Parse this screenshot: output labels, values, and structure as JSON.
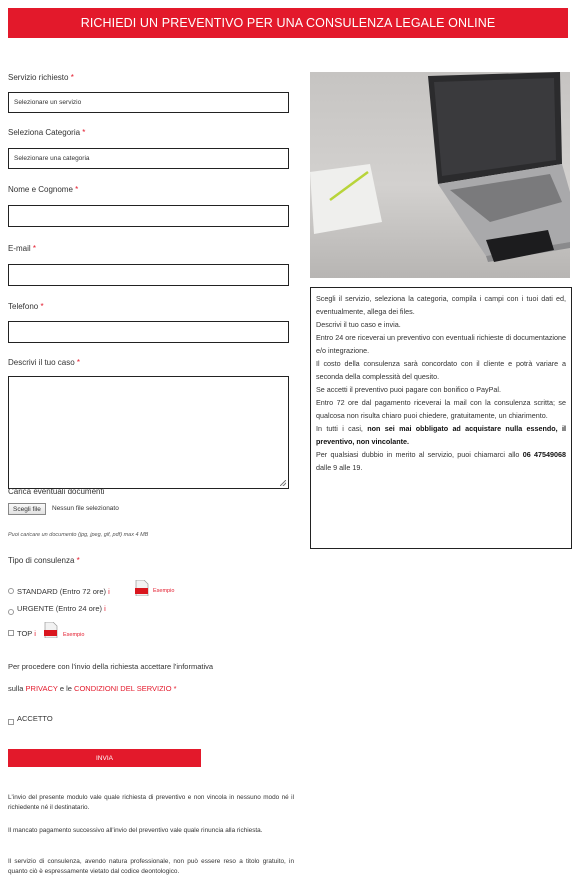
{
  "banner": "RICHIEDI UN PREVENTIVO PER UNA CONSULENZA LEGALE ONLINE",
  "form": {
    "service_label": "Servizio richiesto",
    "service_value": "Selezionare un servizio",
    "category_label": "Seleziona Categoria",
    "category_value": "Selezionare una categoria",
    "name_label": "Nome e Cognome",
    "email_label": "E-mail",
    "phone_label": "Telefono",
    "case_label": "Descrivi il tuo caso",
    "upload_label": "Carica eventuali documenti",
    "file_button": "Scegli file",
    "file_status": "Nessun file selezionato",
    "upload_hint": "Puoi caricare un documento (jpg, jpeg, gif, pdf) max 4 MB",
    "type_label": "Tipo di consulenza",
    "options": [
      {
        "label": "STANDARD (Entro 72 ore)",
        "info": "i",
        "example": "Esempio"
      },
      {
        "label": "URGENTE (Entro 24 ore)",
        "info": "i"
      },
      {
        "label": "TOP",
        "info": "i",
        "example": "Esempio"
      }
    ],
    "privacy_line1": "Per procedere con l'invio della richiesta accettare l'informativa",
    "privacy_prefix": "sulla",
    "privacy_link": "PRIVACY",
    "privacy_mid": "e le",
    "conditions_link": "CONDIZIONI DEL SERVIZIO",
    "accept_label": "ACCETTO",
    "submit": "INVIA",
    "required_mark": "*"
  },
  "info": {
    "p1": "Scegli il servizio, seleziona la categoria, compila i campi con i tuoi dati ed, eventualmente, allega dei files.",
    "p2": "Descrivi il tuo caso e invia.",
    "p3": "Entro 24 ore riceverai un preventivo con eventuali richieste di documentazione e/o integrazione.",
    "p4": "Il costo della consulenza sarà concordato con il cliente e potrà variare a seconda della complessità del quesito.",
    "p5": "Se accetti il preventivo puoi pagare con bonifico o PayPal.",
    "p6": "Entro 72 ore dal pagamento riceverai la mail con la consulenza scritta; se qualcosa non risulta chiaro puoi chiedere, gratuitamente, un chiarimento.",
    "p7_pre": "In tutti i casi,",
    "p7_bold": "non sei mai obbligato ad acquistare nulla essendo, il preventivo, non vincolante.",
    "p8": "Per qualsiasi dubbio in merito al servizio, puoi chiamarci allo",
    "phone": "06 47549068",
    "p8_end": "dalle 9 alle 19."
  },
  "footer": {
    "f1": "L'invio del presente modulo vale quale richiesta di preventivo e non vincola in nessuno modo né il richiedente né il destinatario.",
    "f2": "Il mancato pagamento successivo all'invio del preventivo vale quale rinuncia alla richiesta.",
    "f3": "Il servizio di consulenza, avendo natura professionale, non può essere reso a titolo gratuito, in quanto ciò è espressamente vietato dal codice deontologico."
  },
  "colors": {
    "accent": "#e3192b",
    "text": "#333333",
    "border": "#222222"
  },
  "icons": [
    "pdf-icon",
    "laptop-photo"
  ]
}
